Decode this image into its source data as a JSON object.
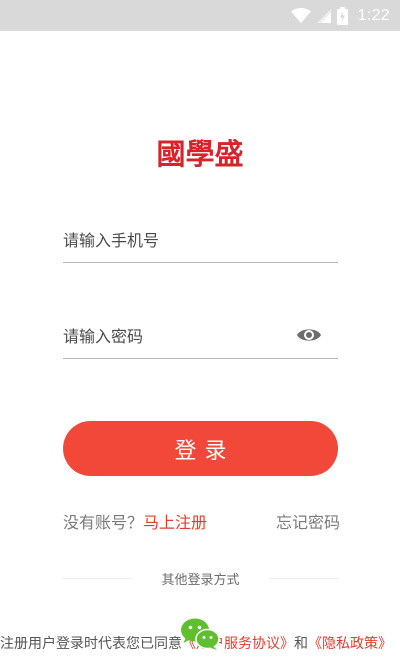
{
  "status_bar": {
    "time": "1:22",
    "icons": [
      "wifi-icon",
      "signal-icon",
      "battery-icon"
    ]
  },
  "logo": {
    "text": "國學盛",
    "color": "#d8232a"
  },
  "form": {
    "phone_placeholder": "请输入手机号",
    "password_placeholder": "请输入密码",
    "login_button": "登录"
  },
  "links": {
    "no_account": "没有账号？",
    "register": "马上注册",
    "forgot_password": "忘记密码"
  },
  "other_login": {
    "label": "其他登录方式",
    "method_icon": "wechat-icon"
  },
  "agreement": {
    "prefix": "注册用户登录时代表您已同意",
    "user_agreement": "《用户服务协议》",
    "conjunction": "和",
    "privacy_policy": "《隐私政策》"
  },
  "colors": {
    "accent": "#f2483a",
    "link": "#e53c2c",
    "wechat": "#5fbf2f",
    "status_bar": "#d9d9d9"
  }
}
